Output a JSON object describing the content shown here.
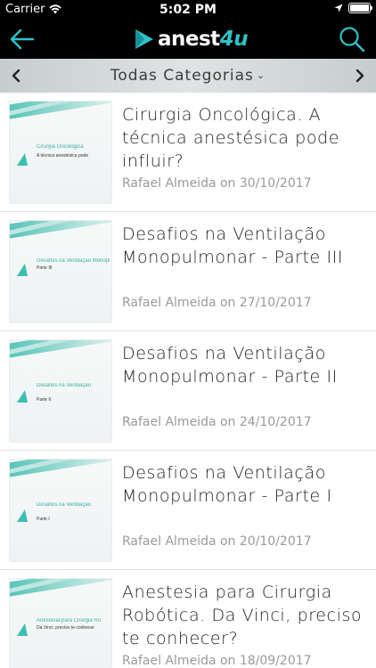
{
  "status_bar": {
    "carrier": "Carrier",
    "time": "5:02 PM"
  },
  "nav": {
    "logo_main": "anest",
    "logo_accent": "4u",
    "back_icon": "arrow-left-icon",
    "search_icon": "search-icon",
    "accent_color": "#2ec1c9"
  },
  "category_bar": {
    "title": "Todas Categorias",
    "dropdown_icon": "chevron-down-icon",
    "prev_icon": "chevron-left-icon",
    "next_icon": "chevron-right-icon"
  },
  "posts": [
    {
      "title": "Cirurgia Oncológica. A técnica anestésica pode influir?",
      "meta": "Rafael Almeida on 30/10/2017",
      "thumb_title": "Cirurgia Oncológica",
      "thumb_sub": "A técnica anestésica pode"
    },
    {
      "title": "Desafios na Ventilação Monopulmonar - Parte III",
      "meta": "Rafael Almeida on 27/10/2017",
      "thumb_title": "Desafios na Ventilação Monopulmonar",
      "thumb_sub": "Parte III"
    },
    {
      "title": "Desafios na Ventilação Monopulmonar - Parte II",
      "meta": "Rafael Almeida on 24/10/2017",
      "thumb_title": "Desafios na Ventilação",
      "thumb_sub": "Parte II"
    },
    {
      "title": "Desafios na Ventilação Monopulmonar - Parte I",
      "meta": "Rafael Almeida on 20/10/2017",
      "thumb_title": "Desafios na Ventilação",
      "thumb_sub": "Parte I"
    },
    {
      "title": "Anestesia para Cirurgia Robótica. Da Vinci, preciso te conhecer?",
      "meta": "Rafael Almeida on 18/09/2017",
      "thumb_title": "Anestesia para Cirurgia Ro",
      "thumb_sub": "Da Vinci, preciso te conhecer"
    }
  ]
}
